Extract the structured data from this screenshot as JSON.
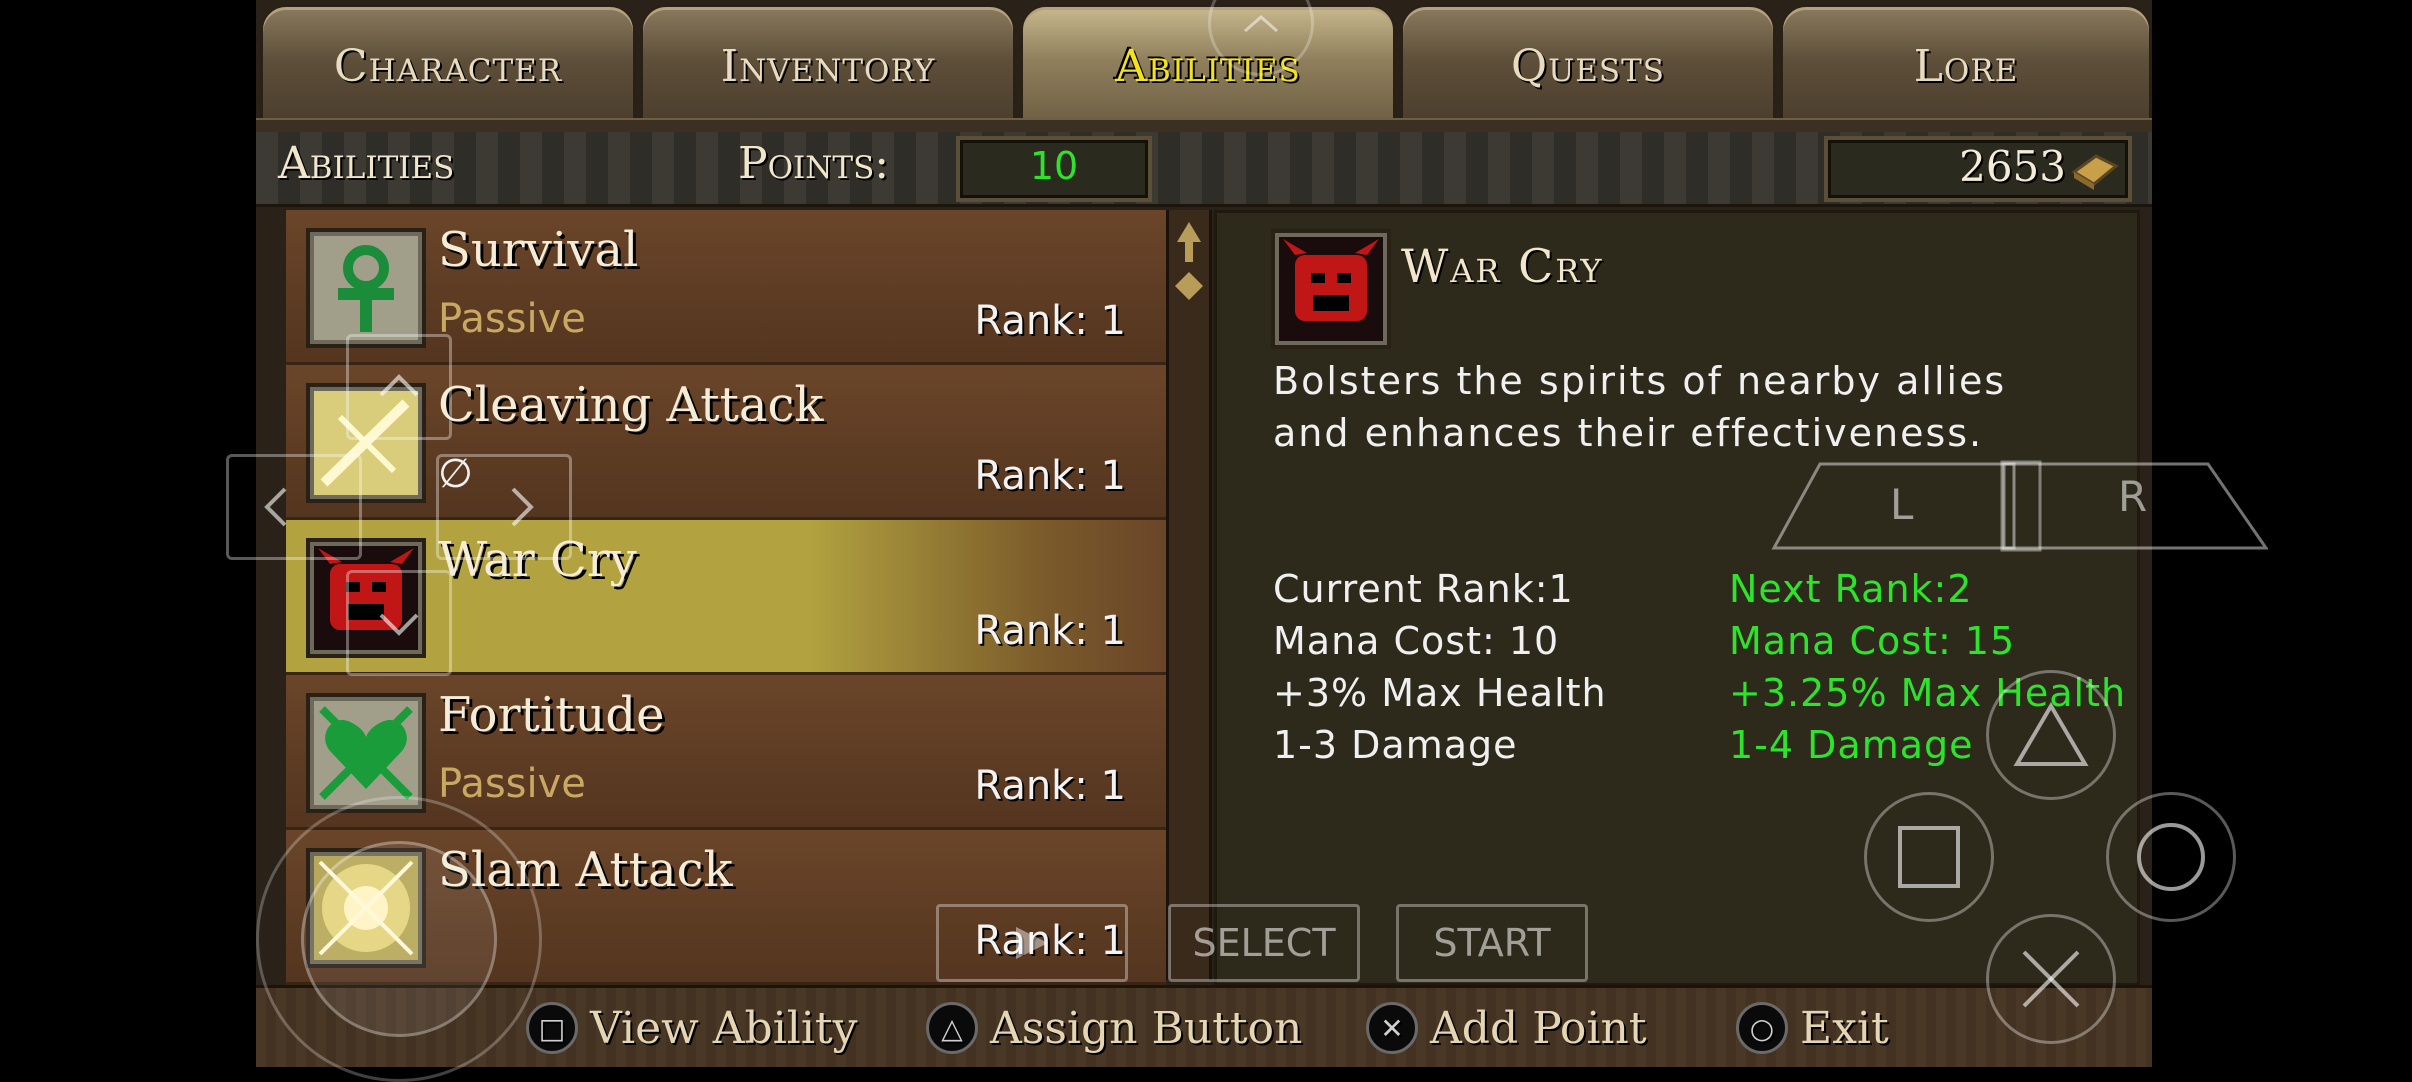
{
  "tabs": [
    {
      "label": "Character",
      "active": false
    },
    {
      "label": "Inventory",
      "active": false
    },
    {
      "label": "Abilities",
      "active": true
    },
    {
      "label": "Quests",
      "active": false
    },
    {
      "label": "Lore",
      "active": false
    }
  ],
  "header": {
    "section_label": "Abilities",
    "points_label": "Points:",
    "points_value": "10",
    "gold_value": "2653"
  },
  "abilities": [
    {
      "name": "Survival",
      "sub": "Passive",
      "rank": "Rank: 1",
      "icon": "ankh-icon"
    },
    {
      "name": "Cleaving Attack",
      "sub": "∅",
      "rank": "Rank: 1",
      "icon": "cleave-icon"
    },
    {
      "name": "War Cry",
      "sub": "",
      "rank": "Rank: 1",
      "icon": "war-cry-icon"
    },
    {
      "name": "Fortitude",
      "sub": "Passive",
      "rank": "Rank: 1",
      "icon": "heart-icon"
    },
    {
      "name": "Slam Attack",
      "sub": "",
      "rank": "Rank: 1",
      "icon": "slam-icon"
    }
  ],
  "detail": {
    "title": "War Cry",
    "desc_line1": "Bolsters the spirits of nearby allies",
    "desc_line2": "and enhances their effectiveness.",
    "current": [
      "Current Rank:1",
      "Mana Cost: 10",
      "+3% Max Health",
      "1-3 Damage"
    ],
    "next": [
      "Next Rank:2",
      "Mana Cost: 15",
      "+3.25% Max Health",
      "1-4 Damage"
    ]
  },
  "footer": [
    {
      "glyph": "□",
      "label": "View Ability"
    },
    {
      "glyph": "△",
      "label": "Assign Button"
    },
    {
      "glyph": "✕",
      "label": "Add Point"
    },
    {
      "glyph": "○",
      "label": "Exit"
    }
  ],
  "overlay": {
    "l_label": "L",
    "r_label": "R",
    "select_label": "SELECT",
    "start_label": "START"
  },
  "colors": {
    "accent_yellow": "#f4e21a",
    "green_text": "#2ee42b",
    "selected_row": "#b2a340"
  }
}
